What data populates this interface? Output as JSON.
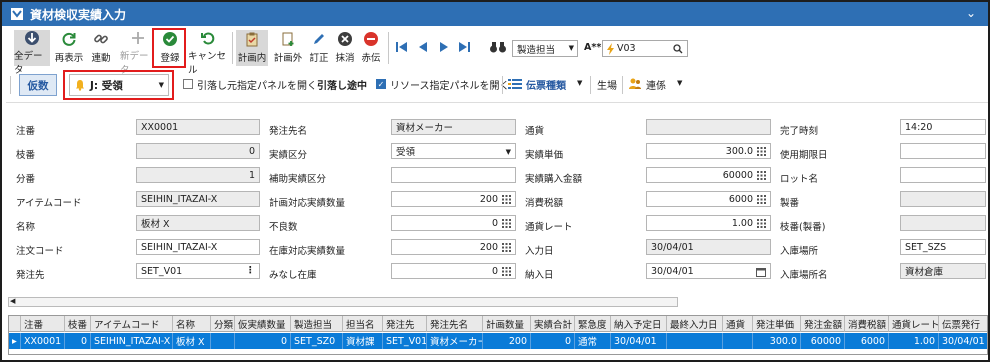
{
  "window": {
    "title": "資材検収実績入力"
  },
  "toolbar": {
    "all_data": "全データ",
    "redisplay": "再表示",
    "link": "連動",
    "new_data": "新データ",
    "register": "登録",
    "cancel": "キャンセル",
    "in_plan": "計画内",
    "out_plan": "計画外",
    "correct": "訂正",
    "erase": "抹消",
    "red_slip": "赤伝",
    "filter_select": "製造担当",
    "font_label": "A**",
    "search_value": "V03"
  },
  "toolbar2": {
    "kari_button": "仮数",
    "mode_select": "J: 受領",
    "hikiotoshi_panel": "引落し元指定パネルを開く",
    "hikiotoshi_status": "引落し途中",
    "resource_panel": "リソース指定パネルを開く",
    "slip_type": "伝票種類",
    "production": "生場",
    "link_menu": "連係"
  },
  "form": {
    "col1": [
      {
        "label": "注番",
        "value": "XX0001"
      },
      {
        "label": "枝番",
        "value": "0"
      },
      {
        "label": "分番",
        "value": "1"
      },
      {
        "label": "アイテムコード",
        "value": "SEIHIN_ITAZAI-X"
      },
      {
        "label": "名称",
        "value": "板材 X"
      },
      {
        "label": "注文コード",
        "value": "SEIHIN_ITAZAI-X"
      },
      {
        "label": "発注先",
        "value": "SET_V01"
      }
    ],
    "col2": [
      {
        "label": "発注先名",
        "value": "資材メーカー"
      },
      {
        "label": "実績区分",
        "value": "受領"
      },
      {
        "label": "補助実績区分",
        "value": ""
      },
      {
        "label": "計画対応実績数量",
        "value": "200"
      },
      {
        "label": "不良数",
        "value": "0"
      },
      {
        "label": "在庫対応実績数量",
        "value": "200"
      },
      {
        "label": "みなし在庫",
        "value": "0"
      }
    ],
    "col3": [
      {
        "label": "通貨",
        "value": ""
      },
      {
        "label": "実績単価",
        "value": "300.0"
      },
      {
        "label": "実績購入金額",
        "value": "60000"
      },
      {
        "label": "消費税額",
        "value": "6000"
      },
      {
        "label": "通貨レート",
        "value": "1.00"
      },
      {
        "label": "入力日",
        "value": "30/04/01"
      },
      {
        "label": "納入日",
        "value": "30/04/01"
      }
    ],
    "col4": [
      {
        "label": "完了時刻",
        "value": "14:20"
      },
      {
        "label": "使用期限日",
        "value": ""
      },
      {
        "label": "ロット名",
        "value": ""
      },
      {
        "label": "製番",
        "value": ""
      },
      {
        "label": "枝番(製番)",
        "value": ""
      },
      {
        "label": "入庫場所",
        "value": "SET_SZS"
      },
      {
        "label": "入庫場所名",
        "value": "資材倉庫"
      }
    ]
  },
  "table": {
    "headers": [
      "注番",
      "枝番",
      "アイテムコード",
      "名称",
      "分類",
      "仮実績数量",
      "製造担当",
      "担当名",
      "発注先",
      "発注先名",
      "計画数量",
      "実績合計",
      "緊急度",
      "納入予定日",
      "最終入力日",
      "通貨",
      "発注単価",
      "発注金額",
      "消費税額",
      "通貨レート",
      "伝票発行"
    ],
    "row": [
      "XX0001",
      "0",
      "SEIHIN_ITAZAI-X",
      "板材 X",
      "",
      "0",
      "SET_SZ0",
      "資材課",
      "SET_V01",
      "資材メーカー",
      "200",
      "0",
      "通常",
      "30/04/01",
      "",
      "",
      "300.0",
      "60000",
      "6000",
      "1.00",
      "30/04/01"
    ]
  },
  "colors": {
    "titlebar": "#2e6fb4",
    "selected_row": "#0a7bd8",
    "highlight_box": "#e21c1c"
  }
}
